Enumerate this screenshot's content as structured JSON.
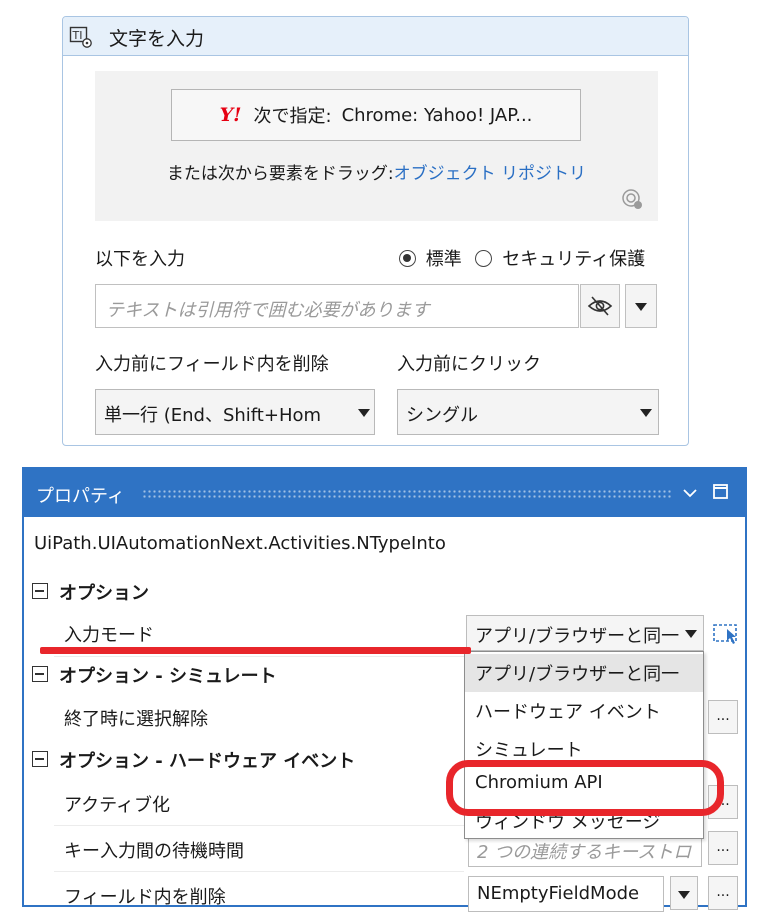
{
  "activity": {
    "title": "文字を入力",
    "target_prefix": "次で指定:",
    "target_value": "Chrome: Yahoo! JAP...",
    "yahoo_logo": "Y!",
    "drag_text": "または次から要素をドラッグ:",
    "drag_link": "オブジェクト リポジトリ",
    "input_label": "以下を入力",
    "radio_standard": "標準",
    "radio_secure": "セキュリティ保護",
    "text_placeholder": "テキストは引用符で囲む必要があります",
    "clear_label": "入力前にフィールド内を削除",
    "clear_value": "単一行 (End、Shift+Hom",
    "click_label": "入力前にクリック",
    "click_value": "シングル"
  },
  "properties": {
    "title": "プロパティ",
    "class_name": "UiPath.UIAutomationNext.Activities.NTypeInto",
    "cat_options": "オプション",
    "input_mode_label": "入力モード",
    "input_mode_value": "アプリ/ブラウザーと同一",
    "cat_simulate": "オプション - シミュレート",
    "deselect_label": "終了時に選択解除",
    "cat_hardware": "オプション - ハードウェア イベント",
    "activate_label": "アクティブ化",
    "delay_label": "キー入力間の待機時間",
    "delay_placeholder": "2 つの連続するキーストロ",
    "empty_field_label": "フィールド内を削除",
    "empty_field_value": "NEmptyFieldMode",
    "dots": "...",
    "dropdown_options": [
      "アプリ/ブラウザーと同一",
      "ハードウェア イベント",
      "シミュレート",
      "Chromium API",
      "ウィンドウ メッセージ"
    ]
  },
  "colors": {
    "accent": "#2f73c4",
    "annotation": "#e8262b",
    "link": "#2a6fc4"
  }
}
